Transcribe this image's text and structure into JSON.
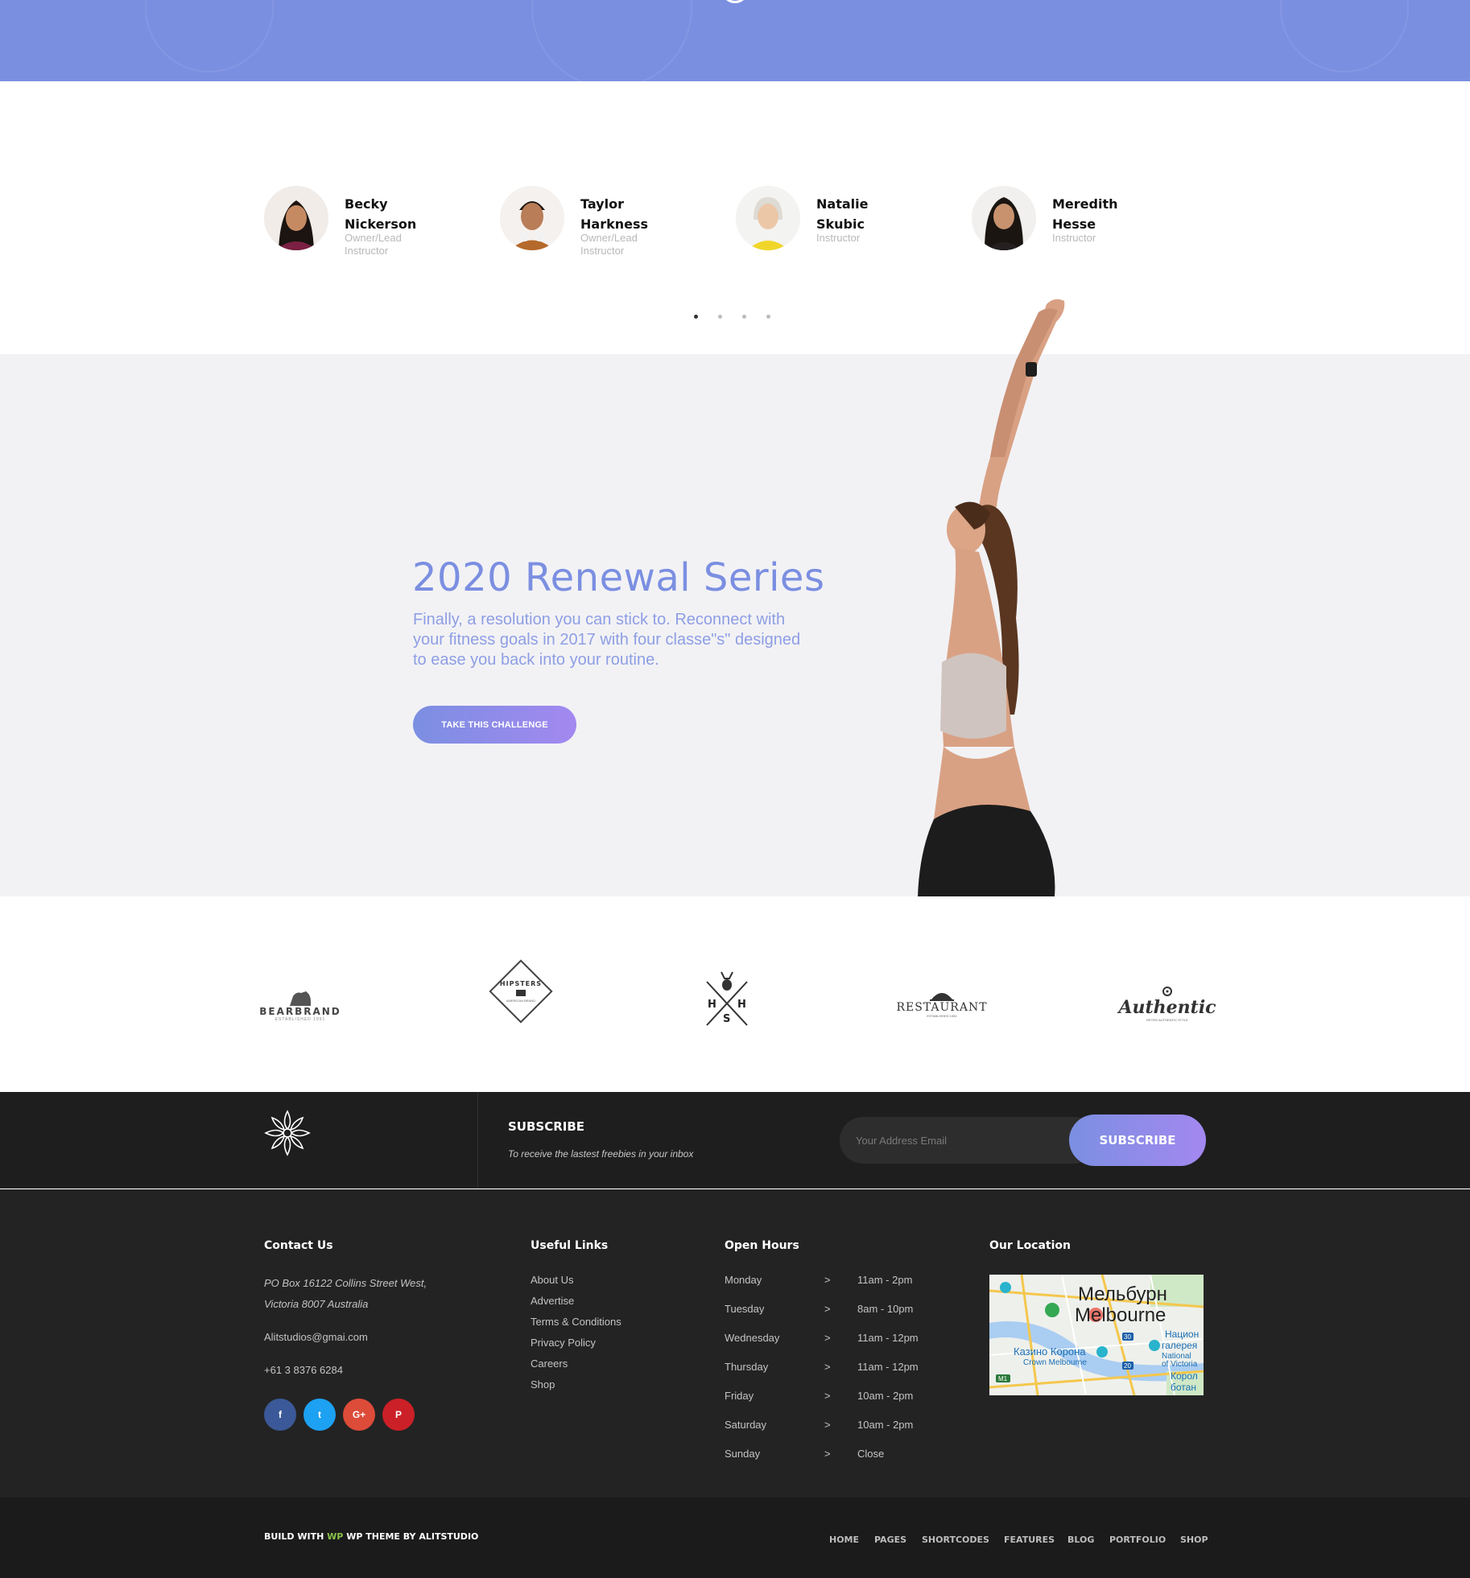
{
  "instructors": [
    {
      "first": "Becky",
      "last": "Nickerson",
      "role_line1": "Owner/Lead",
      "role_line2": "Instructor"
    },
    {
      "first": "Taylor",
      "last": "Harkness",
      "role_line1": "Owner/Lead",
      "role_line2": "Instructor"
    },
    {
      "first": "Natalie",
      "last": "Skubic",
      "role_line1": "Instructor",
      "role_line2": ""
    },
    {
      "first": "Meredith",
      "last": "Hesse",
      "role_line1": "Instructor",
      "role_line2": ""
    }
  ],
  "carousel": {
    "active_dot": 1,
    "dot_count": 4
  },
  "hero": {
    "title": "2020 Renewal Series",
    "text": "Finally, a resolution you can stick to. Reconnect with your fitness goals in 2017 with four classe\"s\" designed to ease you back into your routine.",
    "button": "TAKE THIS CHALLENGE"
  },
  "brands": [
    {
      "name": "BEARBRAND",
      "sub": "ESTABLISHED 1991"
    },
    {
      "name": "HIPSTERS",
      "sub": "AMERICAN BRAND"
    },
    {
      "name": "HHS",
      "sub": ""
    },
    {
      "name": "RESTAURANT",
      "sub": "ESTABLISHED 1981"
    },
    {
      "name": "Authentic",
      "sub": "RETRO AUTHENTIC STYLE"
    }
  ],
  "subscribe": {
    "title": "SUBSCRIBE",
    "desc": "To receive the lastest freebies in your inbox",
    "placeholder": "Your Address Email",
    "button": "SUBSCRIBE"
  },
  "footer": {
    "contact": {
      "title": "Contact Us",
      "address1": "PO Box 16122 Collins Street West,",
      "address2": "Victoria 8007 Australia",
      "email": "Alitstudios@gmai.com",
      "phone": "+61 3 8376 6284"
    },
    "social": [
      {
        "icon": "facebook-icon",
        "glyph": "f",
        "color": "#3b5998"
      },
      {
        "icon": "twitter-icon",
        "glyph": "t",
        "color": "#1da1f2"
      },
      {
        "icon": "google-plus-icon",
        "glyph": "G+",
        "color": "#dd4b39"
      },
      {
        "icon": "pinterest-icon",
        "glyph": "P",
        "color": "#cb2027"
      }
    ],
    "links": {
      "title": "Useful Links",
      "items": [
        "About Us",
        "Advertise",
        "Terms & Conditions",
        "Privacy Policy",
        "Careers",
        "Shop"
      ]
    },
    "hours": {
      "title": "Open Hours",
      "rows": [
        {
          "day": "Monday",
          "arrow": ">",
          "time": "11am - 2pm"
        },
        {
          "day": "Tuesday",
          "arrow": ">",
          "time": "8am - 10pm"
        },
        {
          "day": "Wednesday",
          "arrow": ">",
          "time": "11am - 12pm"
        },
        {
          "day": "Thursday",
          "arrow": ">",
          "time": "11am - 12pm"
        },
        {
          "day": "Friday",
          "arrow": ">",
          "time": "10am - 2pm"
        },
        {
          "day": "Saturday",
          "arrow": ">",
          "time": "10am - 2pm"
        },
        {
          "day": "Sunday",
          "arrow": ">",
          "time": "Close"
        }
      ]
    },
    "location": {
      "title": "Our Location",
      "map_label_ru": "Мельбурн",
      "map_label_en": "Melbourne",
      "map_label_casino": "Казино Корона",
      "map_label_crown": "Crown Melbourne",
      "map_label_gallery1": "Национ",
      "map_label_gallery2": "галерея",
      "map_label_gallery3": "National",
      "map_label_gallery4": "of Victoria",
      "map_label_royal1": "Корол",
      "map_label_royal2": "ботан",
      "map_badge_30": "30",
      "map_badge_20": "20",
      "map_badge_m1": "M1"
    }
  },
  "bottom": {
    "credit_before": "BUILD WITH",
    "credit_wp": "WP",
    "credit_after": "WP THEME BY ALITSTUDIO",
    "nav": [
      "HOME",
      "PAGES",
      "SHORTCODES",
      "FEATURES",
      "BLOG",
      "PORTFOLIO",
      "SHOP"
    ]
  },
  "colors": {
    "accent": "#7b8fe1",
    "accent2": "#a388f0",
    "footer": "#232323"
  }
}
